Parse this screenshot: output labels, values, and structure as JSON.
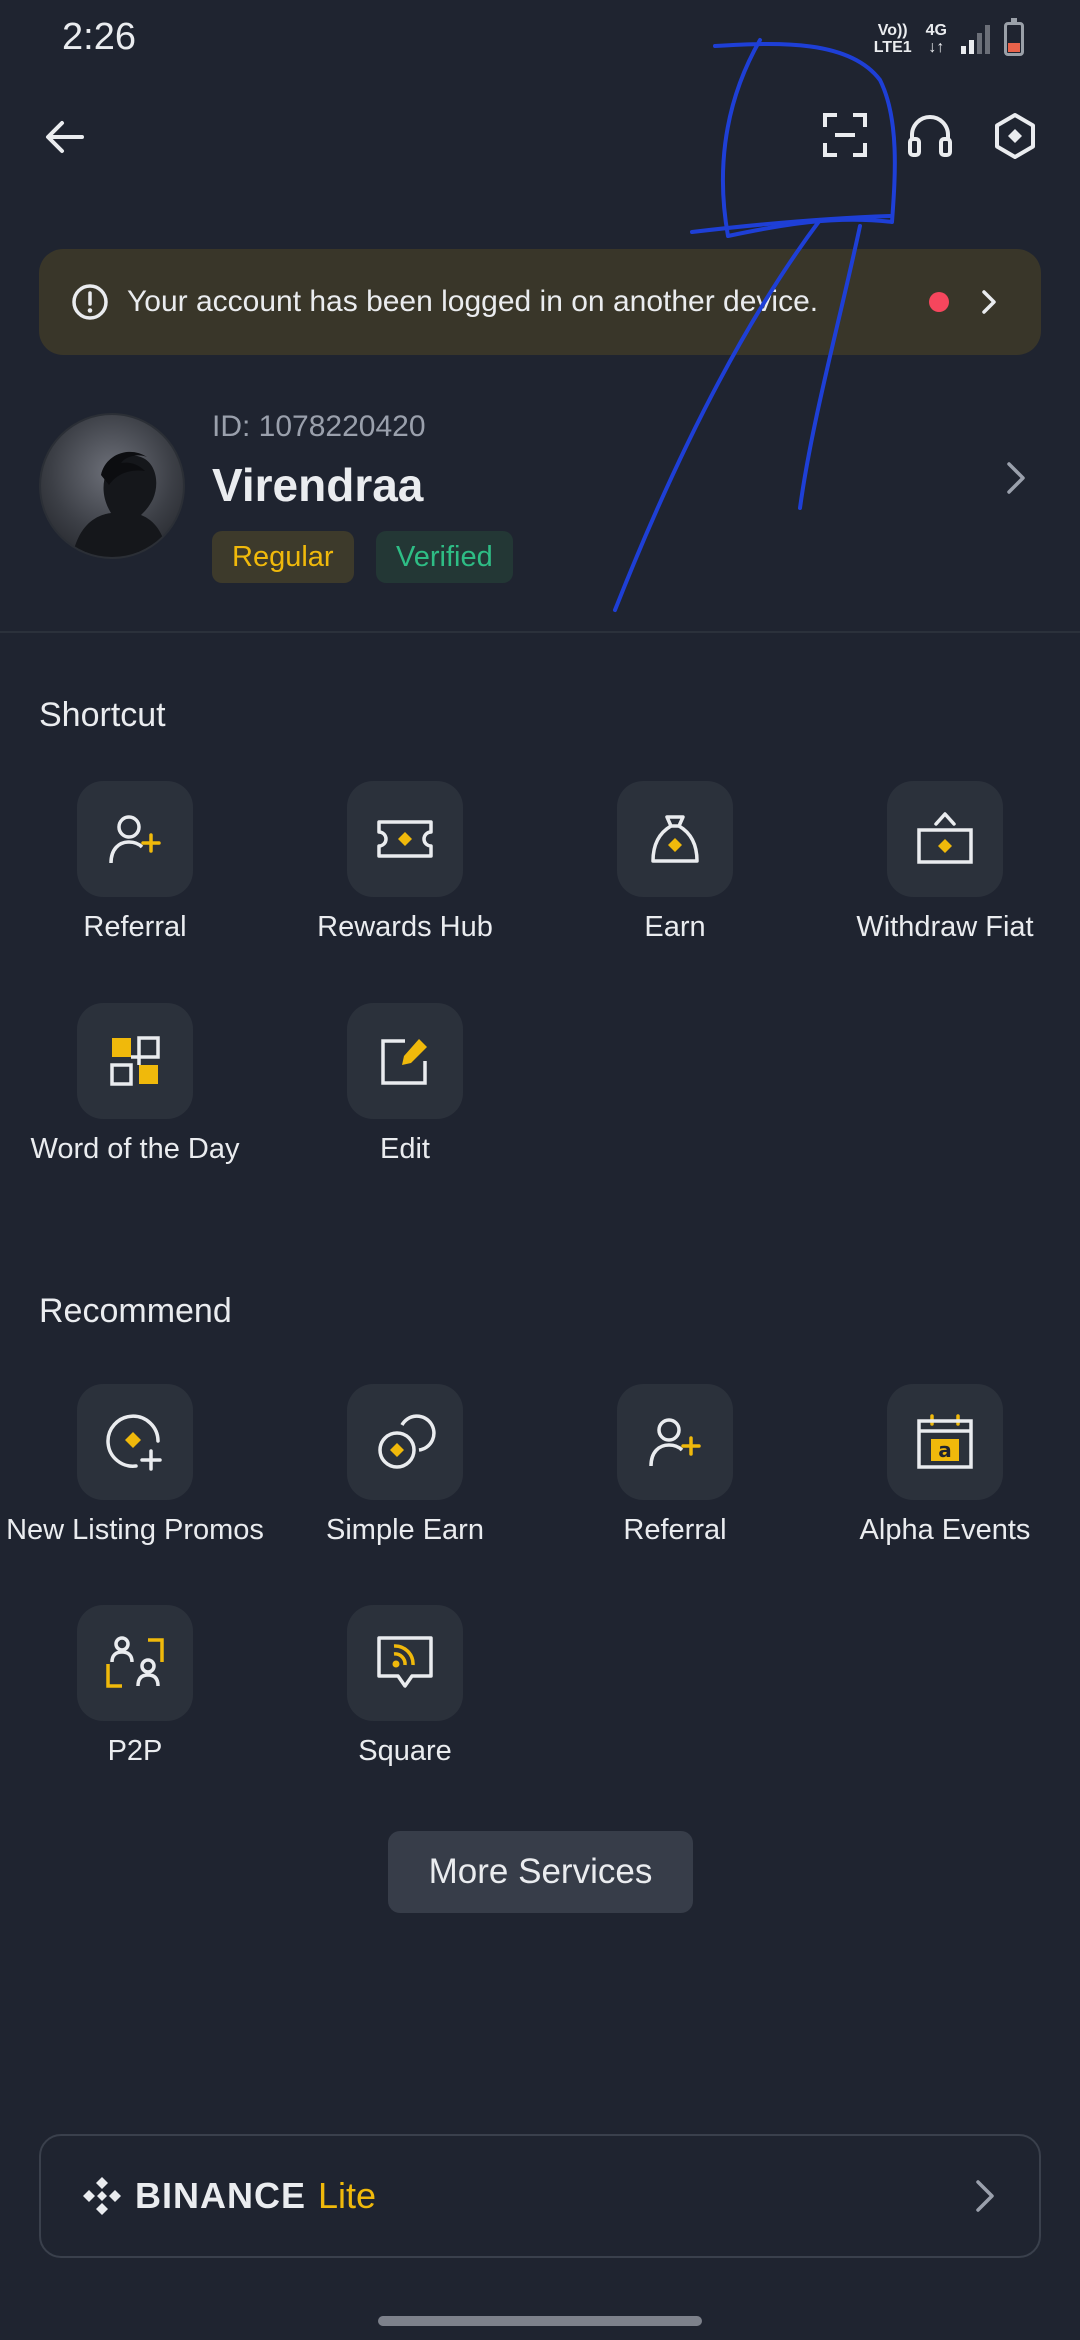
{
  "status_bar": {
    "time": "2:26",
    "network_top": "Vo))",
    "network_bottom": "LTE1",
    "data_top": "4G",
    "data_bottom": "↓↑"
  },
  "top_bar": {
    "back_icon": "arrow-left-icon",
    "scan_icon": "scan-icon",
    "support_icon": "headset-icon",
    "settings_icon": "settings-hexagon-icon"
  },
  "notice": {
    "text": "Your account has been logged in on another device.",
    "icon": "alert-circle-icon",
    "dot_color": "#f6465d"
  },
  "profile": {
    "uid": "ID: 1078220420",
    "name": "Virendraa",
    "badges": [
      "Regular",
      "Verified"
    ]
  },
  "shortcut": {
    "title": "Shortcut",
    "items": [
      {
        "label": "Referral",
        "icon": "add-user-icon"
      },
      {
        "label": "Rewards Hub",
        "icon": "ticket-icon"
      },
      {
        "label": "Earn",
        "icon": "money-bag-icon"
      },
      {
        "label": "Withdraw Fiat",
        "icon": "withdraw-icon"
      },
      {
        "label": "Word of the Day",
        "icon": "puzzle-grid-icon"
      },
      {
        "label": "Edit",
        "icon": "edit-icon"
      }
    ]
  },
  "recommend": {
    "title": "Recommend",
    "items": [
      {
        "label": "New Listing Promos",
        "icon": "new-listing-icon"
      },
      {
        "label": "Simple Earn",
        "icon": "coins-icon"
      },
      {
        "label": "Referral",
        "icon": "add-user-icon"
      },
      {
        "label": "Alpha Events",
        "icon": "calendar-alpha-icon"
      },
      {
        "label": "P2P",
        "icon": "p2p-icon"
      },
      {
        "label": "Square",
        "icon": "feed-icon"
      }
    ]
  },
  "more_services": "More Services",
  "lite": {
    "brand": "BINANCE",
    "suffix": "Lite"
  },
  "colors": {
    "background": "#1f2430",
    "accent": "#f0b90b",
    "verified": "#2ebd85",
    "scribble": "#1e3fd6"
  }
}
